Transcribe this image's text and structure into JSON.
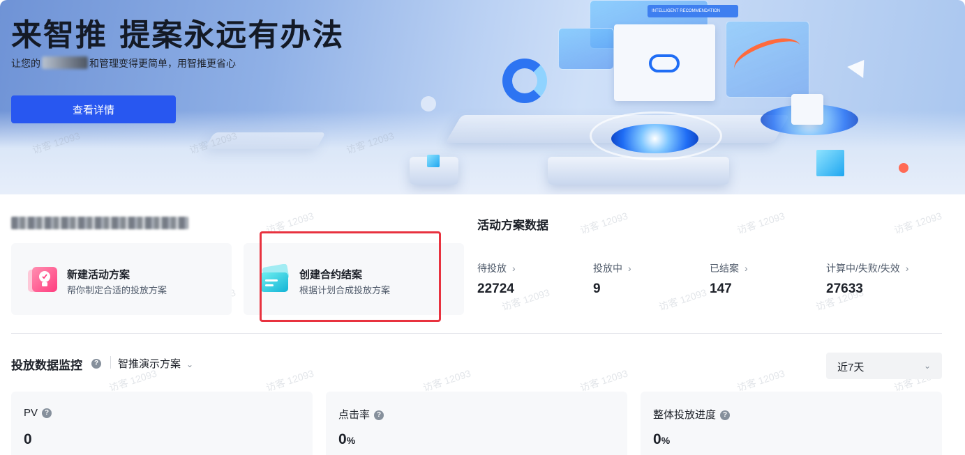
{
  "banner": {
    "title": "来智推 提案永远有办法",
    "subtitle_prefix": "让您的",
    "subtitle_suffix": "和管理变得更简单，用智推更省心",
    "button_label": "查看详情",
    "art_chip_label": "INTELLIGENT RECOMMENDATION"
  },
  "watermark": "访客 12093",
  "actions": [
    {
      "title": "新建活动方案",
      "desc": "帮你制定合适的投放方案",
      "icon": "lightbulb-icon"
    },
    {
      "title": "创建合约结案",
      "desc": "根据计划合成投放方案",
      "icon": "cards-icon"
    }
  ],
  "stats": {
    "title": "活动方案数据",
    "items": [
      {
        "label": "待投放",
        "value": "22724"
      },
      {
        "label": "投放中",
        "value": "9"
      },
      {
        "label": "已结案",
        "value": "147"
      },
      {
        "label": "计算中/失败/失效",
        "value": "27633"
      }
    ]
  },
  "monitor": {
    "title": "投放数据监控",
    "plan": "智推演示方案",
    "range": "近7天",
    "metrics": [
      {
        "label": "PV",
        "value": "0",
        "unit": ""
      },
      {
        "label": "点击率",
        "value": "0",
        "unit": "%"
      },
      {
        "label": "整体投放进度",
        "value": "0",
        "unit": "%"
      }
    ]
  },
  "colors": {
    "primary": "#2857f0",
    "highlight": "#e8323f",
    "card_bg": "#f7f8fa"
  }
}
